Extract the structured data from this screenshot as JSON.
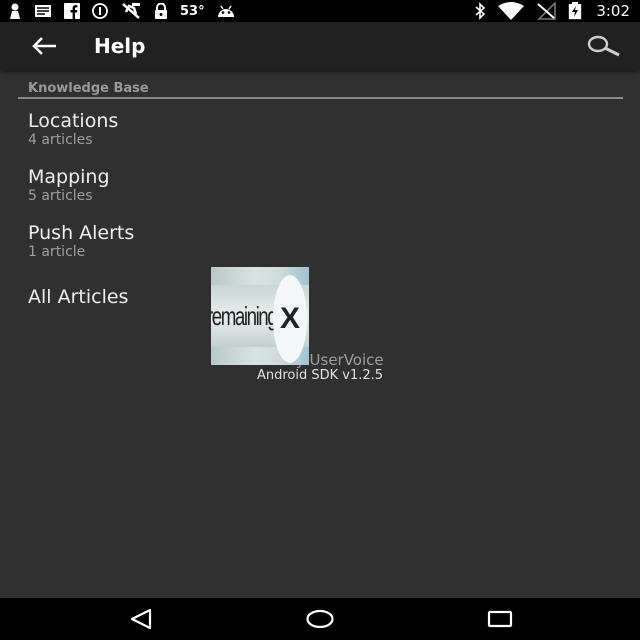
{
  "status_bar": {
    "temperature": "53°",
    "time": "3:02",
    "icons_left": [
      "notification-icon",
      "mail-icon",
      "facebook-icon",
      "alert-icon",
      "no-location-icon",
      "lock-icon"
    ],
    "icons_right": [
      "bluetooth-icon",
      "wifi-icon",
      "no-signal-icon",
      "battery-charging-icon"
    ]
  },
  "toolbar": {
    "title": "Help",
    "back_icon": "arrow-left-icon",
    "search_icon": "search-icon"
  },
  "section": {
    "header": "Knowledge Base"
  },
  "topics": [
    {
      "title": "Locations",
      "count": "4 articles"
    },
    {
      "title": "Mapping",
      "count": "5 articles"
    },
    {
      "title": "Push Alerts",
      "count": "1 article"
    }
  ],
  "all_articles": "All Articles",
  "footer": {
    "powered_by": "by UserVoice",
    "sdk_version": "Android SDK v1.2.5"
  },
  "ad": {
    "text": "remaining",
    "close_label": "X"
  },
  "nav_bar": {
    "icons": [
      "back-triangle-icon",
      "home-circle-icon",
      "recents-square-icon"
    ]
  }
}
